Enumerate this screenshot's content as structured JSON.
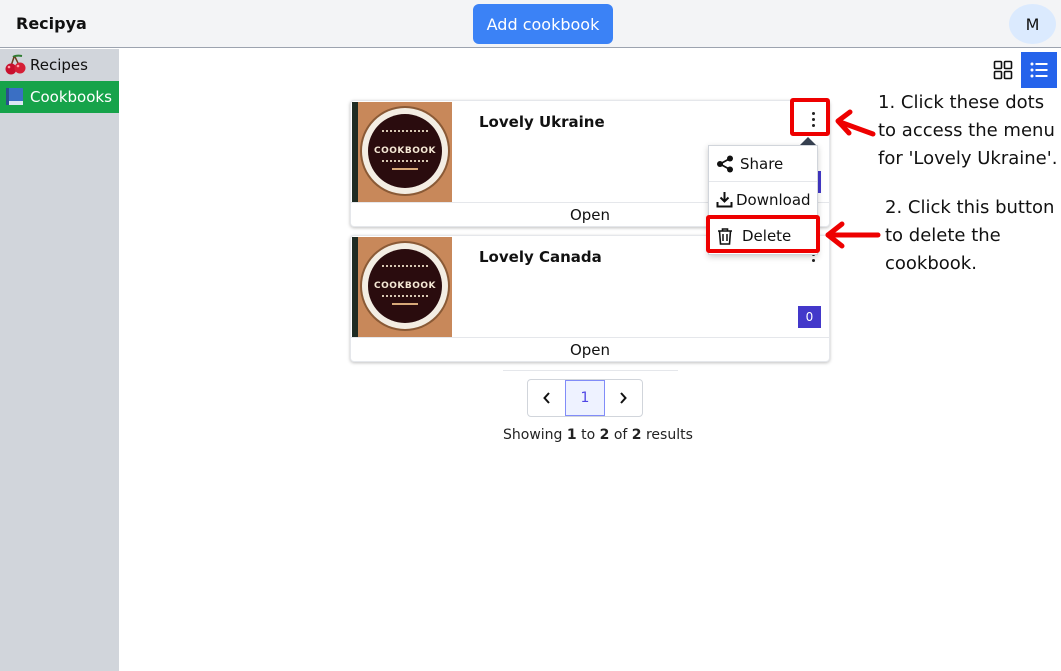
{
  "header": {
    "app_title": "Recipya",
    "add_button_label": "Add cookbook",
    "avatar_initial": "M"
  },
  "sidebar": {
    "items": [
      {
        "label": "Recipes",
        "icon": "cherries-icon",
        "active": false
      },
      {
        "label": "Cookbooks",
        "icon": "book-icon",
        "active": true
      }
    ]
  },
  "view_toggle": {
    "options": [
      "grid-view-icon",
      "list-view-icon"
    ],
    "selected": "list"
  },
  "cookbooks": [
    {
      "title": "Lovely Ukraine",
      "recipe_count": "0",
      "open_label": "Open",
      "cover_text": "COOKBOOK"
    },
    {
      "title": "Lovely Canada",
      "recipe_count": "0",
      "open_label": "Open",
      "cover_text": "COOKBOOK"
    }
  ],
  "dropdown_menu": {
    "items": [
      {
        "label": "Share",
        "icon": "share-icon"
      },
      {
        "label": "Download",
        "icon": "download-icon"
      },
      {
        "label": "Delete",
        "icon": "trash-icon"
      }
    ]
  },
  "annotations": {
    "step1": "1. Click these dots to access the menu for 'Lovely Ukraine'.",
    "step2": "2. Click this button to delete the cookbook.",
    "highlight_color": "#ee0000"
  },
  "pagination": {
    "current_page": "1",
    "showing_prefix": "Showing",
    "from": "1",
    "to_word": "to",
    "to": "2",
    "of_word": "of",
    "total": "2",
    "suffix": "results"
  },
  "colors": {
    "primary": "#3b82f6",
    "active_nav": "#16a34a",
    "badge": "#4338ca",
    "list_toggle": "#2563eb"
  }
}
